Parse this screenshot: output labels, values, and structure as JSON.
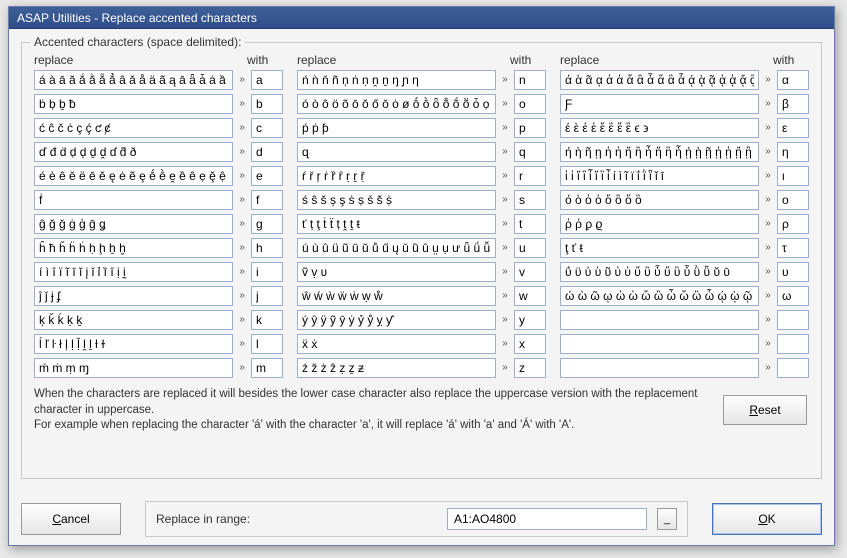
{
  "title": "ASAP Utilities - Replace accented characters",
  "group_legend": "Accented characters (space delimited):",
  "header_replace": "replace",
  "header_with": "with",
  "arrow_glyph": "»",
  "explain_line1": "When the characters are replaced it will besides the lower case character also replace the uppercase version with the replacement character in uppercase.",
  "explain_line2": "For example when replacing the character 'á' with the character 'a', it will replace 'á' with 'a' and 'Á' with 'A'.",
  "reset_label": "Reset",
  "cancel_label": "Cancel",
  "ok_label": "OK",
  "range_label": "Replace in range:",
  "range_value": "A1:AO4800",
  "picker_glyph": "_",
  "columns": [
    [
      {
        "replace": "á à ā ă ắ ằ ẵ ẳ â ǎ å ä ã ą ā ǟ ǡ ȧ ȁ ȃ ạ ḁ ặ ậ ẚ",
        "with": "a"
      },
      {
        "replace": "ḃ ḅ ḇ ƀ",
        "with": "b"
      },
      {
        "replace": "ć ĉ č ċ ç ḉ ƈ ȼ",
        "with": "c"
      },
      {
        "replace": "ď đ ḋ ḍ ḑ ḏ ḓ ɗ ƌ ð",
        "with": "d"
      },
      {
        "replace": "é è ê ě ë ē ĕ ę ė ẽ ȩ ḗ ḕ ḙ ȅ ȇ ẹ ḝ ệ ḛ",
        "with": "e"
      },
      {
        "replace": "ḟ",
        "with": "f"
      },
      {
        "replace": "ĝ ğ ǧ ġ ģ ḡ ǥ",
        "with": "g"
      },
      {
        "replace": "ĥ ħ ȟ ḧ ḣ ḥ ḩ ẖ ḫ",
        "with": "h"
      },
      {
        "replace": "í ì î ï ĩ ī ĭ į ǐ ỉ ȉ ȋ ị ḭ",
        "with": "i"
      },
      {
        "replace": "ĵ ǰ ɉ ʄ",
        "with": "j"
      },
      {
        "replace": "ķ ǩ ḱ ḳ ḵ",
        "with": "k"
      },
      {
        "replace": "ĺ ľ ŀ ł ļ ḷ ḹ ḽ ḻ ƚ ɫ",
        "with": "l"
      },
      {
        "replace": "ḿ ṁ ṃ ɱ",
        "with": "m"
      }
    ],
    [
      {
        "replace": "ń ǹ ň ñ ņ ṅ ṇ ṋ ṉ ŋ ɲ ƞ",
        "with": "n"
      },
      {
        "replace": "ó ò ô ö õ ō ŏ ő ǒ ȯ ø ṓ ṑ ȫ ȭ ṍ ṏ ȱ ọ ơ ǫ ǿ ộ ờ ȍ",
        "with": "o"
      },
      {
        "replace": "ṕ ṗ ƥ",
        "with": "p"
      },
      {
        "replace": "ɋ",
        "with": "q"
      },
      {
        "replace": "ŕ ř ŗ ṙ ȑ ȓ ṛ ṟ ṝ",
        "with": "r"
      },
      {
        "replace": "ś ŝ š ș ş ṡ ṣ ṥ ṧ ṩ",
        "with": "s"
      },
      {
        "replace": "ť ț ţ ṫ ẗ ṭ ṱ ṯ ŧ",
        "with": "t"
      },
      {
        "replace": "ú ù û ü ũ ū ŭ ů ű ų ǔ ȕ ȗ ṳ ụ ư ǖ ǘ ǚ ǜ ủ ứ ừ ự ṵ",
        "with": "u"
      },
      {
        "replace": "ṽ ṿ ʋ",
        "with": "v"
      },
      {
        "replace": "ŵ ẃ ẁ ẅ ẇ ẉ ẘ",
        "with": "w"
      },
      {
        "replace": "ý ŷ ÿ ỹ ȳ ẏ ỷ ẙ ỵ ƴ",
        "with": "y"
      },
      {
        "replace": "ẍ ẋ",
        "with": "x"
      },
      {
        "replace": "ź ž ż ẑ ẓ ẕ ƶ",
        "with": "z"
      }
    ],
    [
      {
        "replace": "ά ὰ ᾶ ᾳ ἀ ἁ ἄ ἂ ἆ ἅ ἃ ἇ ᾴ ᾲ ᾷ ᾀ ᾁ ᾄ ᾂ ᾆ ᾅ ᾃ ᾇ ᾰ ᾱ",
        "with": "α"
      },
      {
        "replace": "Ƒ",
        "with": "β"
      },
      {
        "replace": "έ ὲ ἐ ἑ ἔ ἒ ἕ ἓ ϵ ϶",
        "with": "ε"
      },
      {
        "replace": "ή ὴ ῆ ῃ ἠ ἡ ἤ ἢ ἦ ἥ ἣ ἧ ῄ ῂ ῇ ᾐ ᾑ ᾔ ᾒ ᾖ ᾕ ᾓ ᾗ",
        "with": "η"
      },
      {
        "replace": "ἰ ἱ ἴ ἲ ἶ ἵ ἳ ἷ ί ὶ ῖ ϊ ΐ ῒ ῗ ῐ ῑ",
        "with": "ι"
      },
      {
        "replace": "ό ὸ ὀ ὁ ὄ ὂ ὅ ὃ",
        "with": "ο"
      },
      {
        "replace": "ῥ ῤ ϼ ϱ",
        "with": "ρ"
      },
      {
        "replace": "ţ ť ŧ",
        "with": "τ"
      },
      {
        "replace": "ΰ ϋ ύ ὺ ῦ ὐ ὑ ὔ ὒ ὖ ὕ ὓ ὗ ῢ ῧ ῠ ῡ",
        "with": "υ"
      },
      {
        "replace": "ώ ὼ ῶ ῳ ὠ ὡ ὤ ὢ ὦ ὥ ὣ ὧ ῴ ῲ ῷ ᾠ ᾡ ᾤ ᾢ ᾦ ᾥ ᾣ ᾧ",
        "with": "ω"
      },
      {
        "replace": "",
        "with": ""
      },
      {
        "replace": "",
        "with": ""
      },
      {
        "replace": "",
        "with": ""
      }
    ]
  ]
}
